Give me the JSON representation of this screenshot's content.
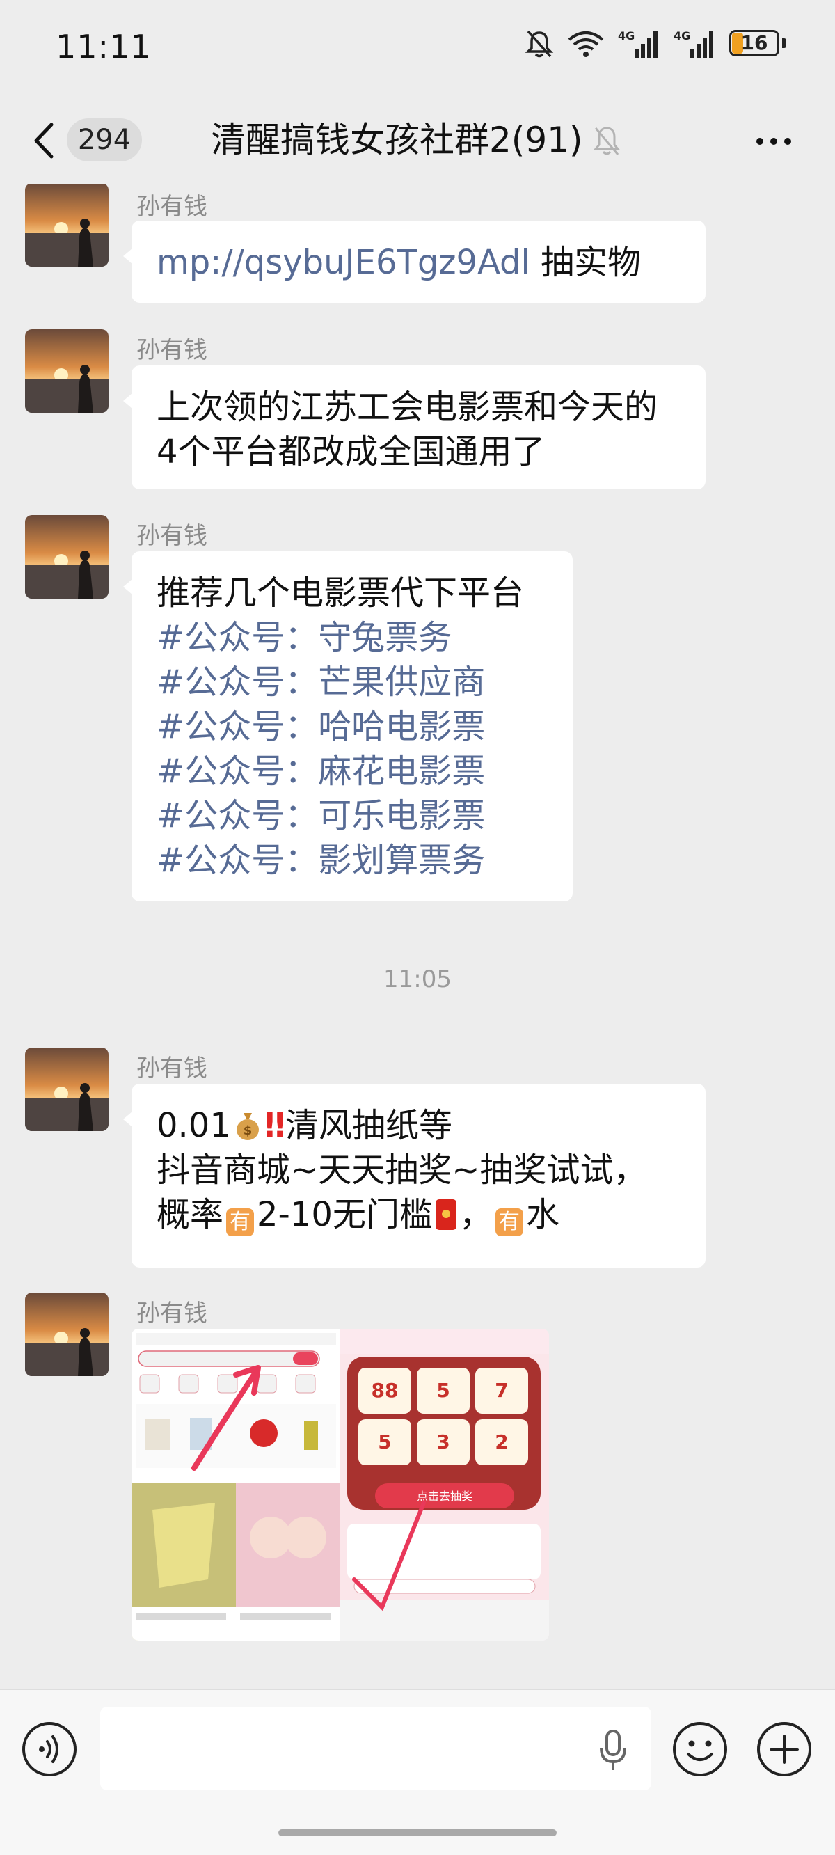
{
  "status_bar": {
    "time": "11:11",
    "battery": "16",
    "network_1": "4G",
    "network_2": "4G"
  },
  "nav": {
    "unread_count": "294",
    "title": "清醒搞钱女孩社群2(91)"
  },
  "messages": [
    {
      "sender": "孙有钱",
      "link": "mp://qsybuJE6Tgz9Adl",
      "text": " 抽实物"
    },
    {
      "sender": "孙有钱",
      "lines": [
        "上次领的江苏工会电影票和今天的",
        "4个平台都改成全国通用了"
      ]
    },
    {
      "sender": "孙有钱",
      "header": "推荐几个电影票代下平台",
      "tags": [
        "#公众号：守兔票务",
        "#公众号：芒果供应商",
        "#公众号：哈哈电影票",
        "#公众号：麻花电影票",
        "#公众号：可乐电影票",
        "#公众号：影划算票务"
      ]
    },
    {
      "sender": "孙有钱",
      "line1_a": "0.01",
      "line1_b": "清风抽纸等",
      "exclam": "‼",
      "line2": "抖音商城~天天抽奖~抽奖试试，",
      "line3_a": "概率",
      "line3_b": "2-10无门槛",
      "line3_c": "，",
      "line3_d": "水",
      "badge_char": "有"
    },
    {
      "sender": "孙有钱",
      "image": {
        "grid_values": [
          "88",
          "5",
          "7",
          "5",
          "3",
          "2"
        ],
        "button_text": "点击去抽奖"
      }
    }
  ],
  "time_divider": "11:05",
  "input": {
    "placeholder": ""
  },
  "colors": {
    "link": "#576b95",
    "background": "#ededed",
    "bubble": "#ffffff",
    "red_packet": "#d9251c",
    "badge": "#f3a04a"
  },
  "icons": [
    "back-icon",
    "mute-bell-icon",
    "more-icon",
    "voice-icon",
    "mic-icon",
    "emoji-icon",
    "plus-icon",
    "wifi-icon",
    "signal-icon",
    "silent-icon",
    "battery-icon"
  ]
}
